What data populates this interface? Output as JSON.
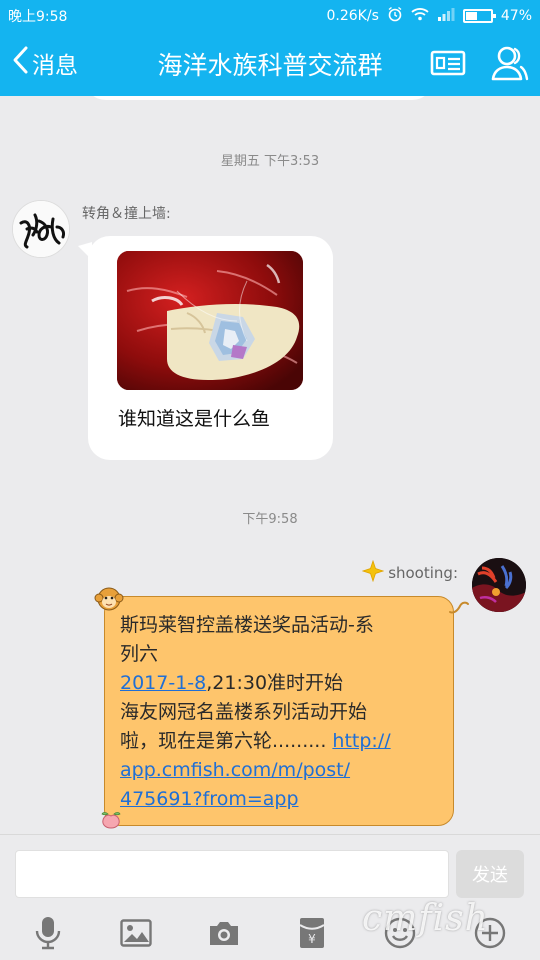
{
  "status_bar": {
    "time": "晚上9:58",
    "network_speed": "0.26K/s",
    "battery_text": "47%",
    "battery_level": 0.47,
    "icons": [
      "alarm-icon",
      "wifi-icon",
      "signal-icon",
      "battery-icon"
    ]
  },
  "header": {
    "back_label": "消息",
    "title": "海洋水族科普交流群",
    "icons": [
      "back-chevron-icon",
      "group-card-icon",
      "group-members-icon"
    ]
  },
  "chat": {
    "timestamp_1": "星期五 下午3:53",
    "message_1": {
      "sender": "转角＆撞上墙:",
      "text": "谁知道这是什么鱼"
    },
    "timestamp_2": "下午9:58",
    "message_2": {
      "sender": "shooting:",
      "line_1": "斯玛莱智控盖楼送奖品活动-系",
      "line_2": "列六",
      "date_link": "2017-1-8",
      "line_3_rest": ",21:30准时开始",
      "line_4": "海友网冠名盖楼系列活动开始",
      "line_5_text": "啦，现在是第六轮......... ",
      "link_part_1": "http://",
      "link_part_2": "app.cmfish.com/m/post/",
      "link_part_3": "475691?from=app"
    }
  },
  "input_bar": {
    "placeholder": "",
    "send_label": "发送",
    "tools": [
      "microphone-icon",
      "image-icon",
      "camera-icon",
      "red-packet-icon",
      "emoji-icon",
      "plus-icon"
    ]
  },
  "watermark": "cmfish",
  "colors": {
    "accent": "#14b4f0",
    "chat_bg": "#ebebed",
    "my_bubble": "#fec56c",
    "link": "#1f6fd6"
  }
}
